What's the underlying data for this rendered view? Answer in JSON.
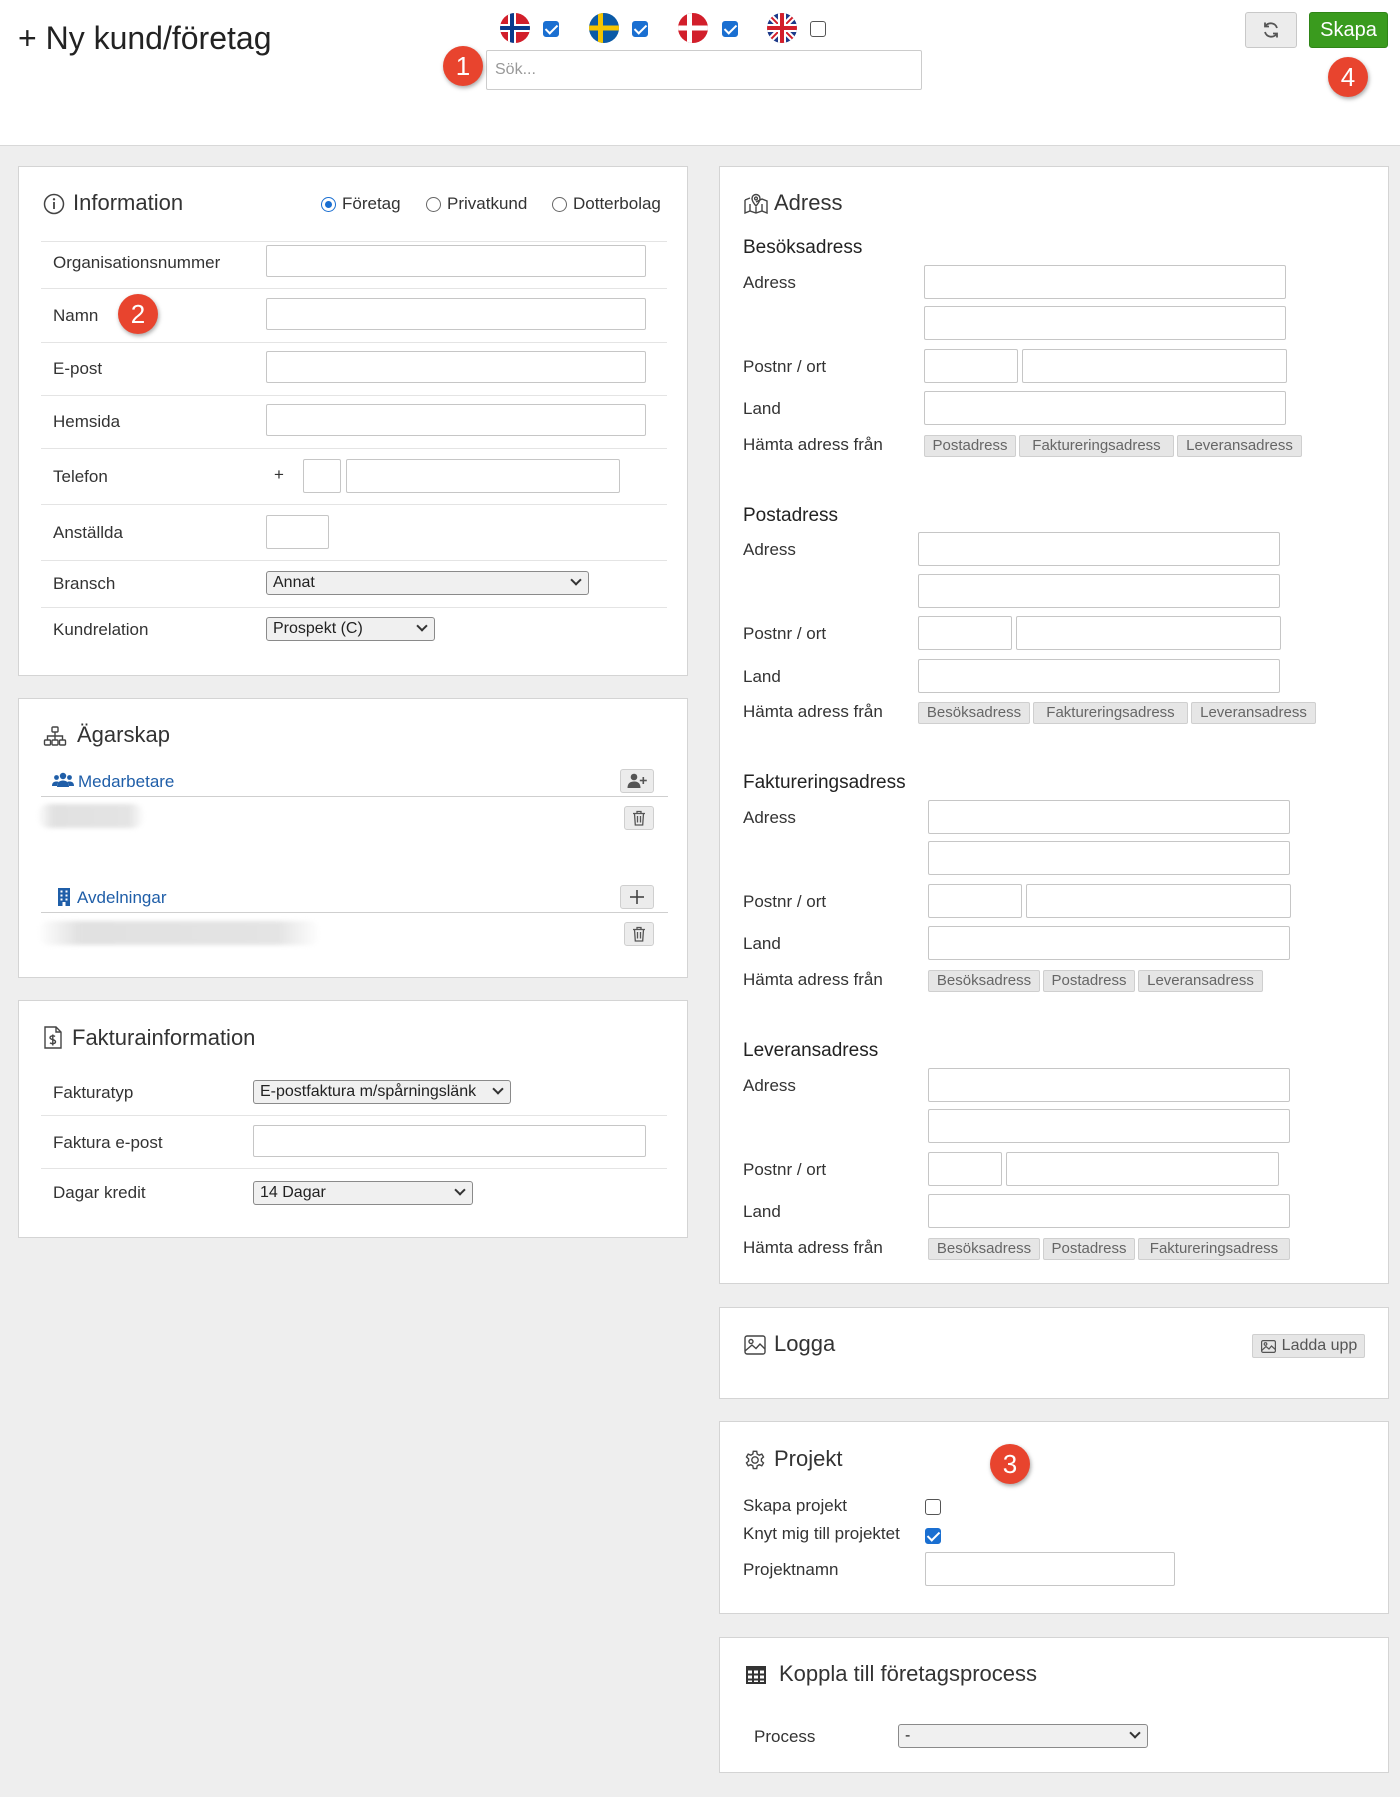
{
  "header": {
    "title": "+ Ny kund/företag",
    "search_placeholder": "Sök...",
    "languages": [
      {
        "flag": "norway-flag-icon",
        "checked": true
      },
      {
        "flag": "sweden-flag-icon",
        "checked": true
      },
      {
        "flag": "denmark-flag-icon",
        "checked": true
      },
      {
        "flag": "uk-flag-icon",
        "checked": false
      }
    ],
    "refresh_icon": "refresh-icon",
    "create_label": "Skapa"
  },
  "badges": {
    "b1": "1",
    "b2": "2",
    "b3": "3",
    "b4": "4"
  },
  "information": {
    "title": "Information",
    "type_options": [
      "Företag",
      "Privatkund",
      "Dotterbolag"
    ],
    "selected_type": "Företag",
    "fields": {
      "org_nr": "Organisationsnummer",
      "name": "Namn",
      "email": "E-post",
      "website": "Hemsida",
      "phone": "Telefon",
      "phone_prefix": "+",
      "employees": "Anställda",
      "industry": "Bransch",
      "industry_value": "Annat",
      "customer_relation": "Kundrelation",
      "customer_relation_value": "Prospekt (C)"
    }
  },
  "ownership": {
    "title": "Ägarskap",
    "colleagues": "Medarbetare",
    "departments": "Avdelningar"
  },
  "invoice": {
    "title": "Fakturainformation",
    "type_label": "Fakturatyp",
    "type_value": "E-postfaktura m/spårningslänk",
    "email_label": "Faktura e-post",
    "credit_label": "Dagar kredit",
    "credit_value": "14 Dagar"
  },
  "address": {
    "title": "Adress",
    "common": {
      "address": "Adress",
      "zip_city": "Postnr / ort",
      "country": "Land",
      "fetch_from": "Hämta adress från"
    },
    "visit": {
      "title": "Besöksadress",
      "sources": [
        "Postadress",
        "Faktureringsadress",
        "Leveransadress"
      ]
    },
    "postal": {
      "title": "Postadress",
      "sources": [
        "Besöksadress",
        "Faktureringsadress",
        "Leveransadress"
      ]
    },
    "billing": {
      "title": "Faktureringsadress",
      "sources": [
        "Besöksadress",
        "Postadress",
        "Leveransadress"
      ]
    },
    "delivery": {
      "title": "Leveransadress",
      "sources": [
        "Besöksadress",
        "Postadress",
        "Faktureringsadress"
      ]
    }
  },
  "logo": {
    "title": "Logga",
    "upload_label": "Ladda upp"
  },
  "project": {
    "title": "Projekt",
    "create_label": "Skapa projekt",
    "create_checked": false,
    "link_me_label": "Knyt mig till projektet",
    "link_me_checked": true,
    "name_label": "Projektnamn"
  },
  "process": {
    "title": "Koppla till företagsprocess",
    "label": "Process",
    "value": "-"
  },
  "colors": {
    "accent": "#1a6fd1",
    "create": "#3a9b1e",
    "badge": "#e8442e",
    "link": "#1f5ea8"
  }
}
